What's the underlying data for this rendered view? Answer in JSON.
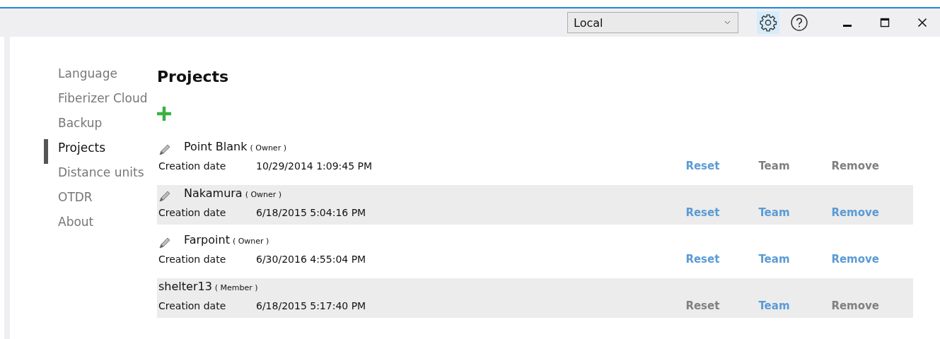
{
  "toolbar": {
    "location": "Local"
  },
  "sidebar": {
    "items": [
      {
        "label": "Language",
        "selected": false
      },
      {
        "label": "Fiberizer Cloud",
        "selected": false
      },
      {
        "label": "Backup",
        "selected": false
      },
      {
        "label": "Projects",
        "selected": true
      },
      {
        "label": "Distance units",
        "selected": false
      },
      {
        "label": "OTDR",
        "selected": false
      },
      {
        "label": "About",
        "selected": false
      }
    ]
  },
  "page": {
    "title": "Projects"
  },
  "projects": [
    {
      "name": "Point Blank",
      "role": "( Owner )",
      "editable": true,
      "date_label": "Creation date",
      "date": "10/29/2014 1:09:45 PM",
      "actions": [
        {
          "label": "Reset",
          "disabled": false
        },
        {
          "label": "Team",
          "disabled": true
        },
        {
          "label": "Remove",
          "disabled": true
        }
      ]
    },
    {
      "name": "Nakamura",
      "role": "( Owner )",
      "editable": true,
      "date_label": "Creation date",
      "date": "6/18/2015 5:04:16 PM",
      "actions": [
        {
          "label": "Reset",
          "disabled": false
        },
        {
          "label": "Team",
          "disabled": false
        },
        {
          "label": "Remove",
          "disabled": false
        }
      ]
    },
    {
      "name": "Farpoint",
      "role": "( Owner )",
      "editable": true,
      "date_label": "Creation date",
      "date": "6/30/2016 4:55:04 PM",
      "actions": [
        {
          "label": "Reset",
          "disabled": false
        },
        {
          "label": "Team",
          "disabled": false
        },
        {
          "label": "Remove",
          "disabled": false
        }
      ]
    },
    {
      "name": "shelter13",
      "role": "( Member )",
      "editable": false,
      "date_label": "Creation date",
      "date": "6/18/2015 5:17:40 PM",
      "actions": [
        {
          "label": "Reset",
          "disabled": true
        },
        {
          "label": "Team",
          "disabled": false
        },
        {
          "label": "Remove",
          "disabled": true
        }
      ]
    }
  ]
}
